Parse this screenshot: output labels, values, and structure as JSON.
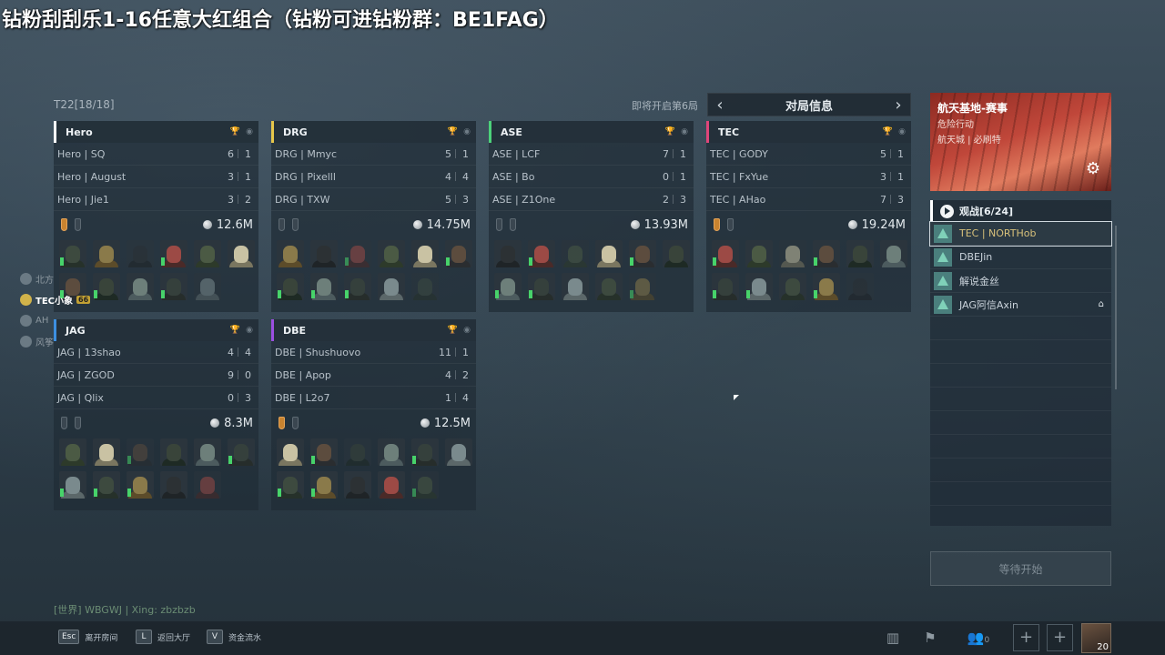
{
  "overlay": {
    "title": "钻粉刮刮乐1-16任意大红组合（钻粉可进钻粉群：BE1FAG）"
  },
  "header": {
    "match_id": "T22[18/18]",
    "round_info": "即将开启第6局",
    "nav_label": "对局信息",
    "prev_arrow": "‹",
    "next_arrow": "›"
  },
  "teams": [
    {
      "name": "Hero",
      "color": "#ffffff",
      "money": "12.6M",
      "badges": [
        "gold",
        "off"
      ],
      "players": [
        {
          "name": "Hero | SQ",
          "k": "6",
          "d": "1"
        },
        {
          "name": "Hero | August",
          "k": "3",
          "d": "1"
        },
        {
          "name": "Hero | Jie1",
          "k": "3",
          "d": "2"
        }
      ]
    },
    {
      "name": "DRG",
      "color": "#e6c64a",
      "money": "14.75M",
      "badges": [
        "off",
        "off"
      ],
      "players": [
        {
          "name": "DRG | Mmyc",
          "k": "5",
          "d": "1"
        },
        {
          "name": "DRG | Pixelll",
          "k": "4",
          "d": "4"
        },
        {
          "name": "DRG | TXW",
          "k": "5",
          "d": "3"
        }
      ]
    },
    {
      "name": "ASE",
      "color": "#4cd17a",
      "money": "13.93M",
      "badges": [
        "off",
        "off"
      ],
      "players": [
        {
          "name": "ASE | LCF",
          "k": "7",
          "d": "1"
        },
        {
          "name": "ASE | Bo",
          "k": "0",
          "d": "1"
        },
        {
          "name": "ASE | Z1One",
          "k": "2",
          "d": "3"
        }
      ]
    },
    {
      "name": "TEC",
      "color": "#e0457a",
      "money": "19.24M",
      "badges": [
        "gold",
        "off"
      ],
      "players": [
        {
          "name": "TEC | GODY",
          "k": "5",
          "d": "1"
        },
        {
          "name": "TEC | FxYue",
          "k": "3",
          "d": "1"
        },
        {
          "name": "TEC | AHao",
          "k": "7",
          "d": "3"
        }
      ]
    },
    {
      "name": "JAG",
      "color": "#3d8fe0",
      "money": "8.3M",
      "badges": [
        "off",
        "off"
      ],
      "players": [
        {
          "name": "JAG | 13shao",
          "k": "4",
          "d": "4"
        },
        {
          "name": "JAG | ZGOD",
          "k": "9",
          "d": "0"
        },
        {
          "name": "JAG | Qlix",
          "k": "0",
          "d": "3"
        }
      ]
    },
    {
      "name": "DBE",
      "color": "#9b4fe0",
      "money": "12.5M",
      "badges": [
        "gold",
        "off"
      ],
      "players": [
        {
          "name": "DBE | Shushuovo",
          "k": "11",
          "d": "1"
        },
        {
          "name": "DBE | Apop",
          "k": "4",
          "d": "2"
        },
        {
          "name": "DBE | L2o7",
          "k": "1",
          "d": "4"
        }
      ]
    }
  ],
  "event": {
    "map": "航天基地-赛事",
    "mode": "危险行动",
    "location": "航天城 | 必刷特",
    "settings_icon": "gear-icon"
  },
  "spectators": {
    "title": "观战[6/24]",
    "list": [
      {
        "name": "TEC | NORTHob",
        "active": true
      },
      {
        "name": "DBEJin",
        "active": false
      },
      {
        "name": "解说金丝",
        "active": false
      },
      {
        "name": "JAG阿信Axin",
        "active": false,
        "host": true
      }
    ]
  },
  "wait_button": "等待开始",
  "left_list": [
    {
      "name": "北方",
      "me": false
    },
    {
      "name": "TEC小象",
      "me": true,
      "tag": "66"
    },
    {
      "name": "AH",
      "me": false
    },
    {
      "name": "风筝",
      "me": false
    }
  ],
  "chat": {
    "line": "[世界] WBGWJ | Xing: zbzbzb"
  },
  "bottom": {
    "leave": {
      "key": "Esc",
      "label": "离开房间"
    },
    "lobby": {
      "key": "L",
      "label": "返回大厅"
    },
    "funds": {
      "key": "V",
      "label": "资金流水"
    },
    "friends_count": "0",
    "avatar_level": "20"
  },
  "colors": {
    "accent": "#d7c07a",
    "marker_green": "#47d36a"
  }
}
